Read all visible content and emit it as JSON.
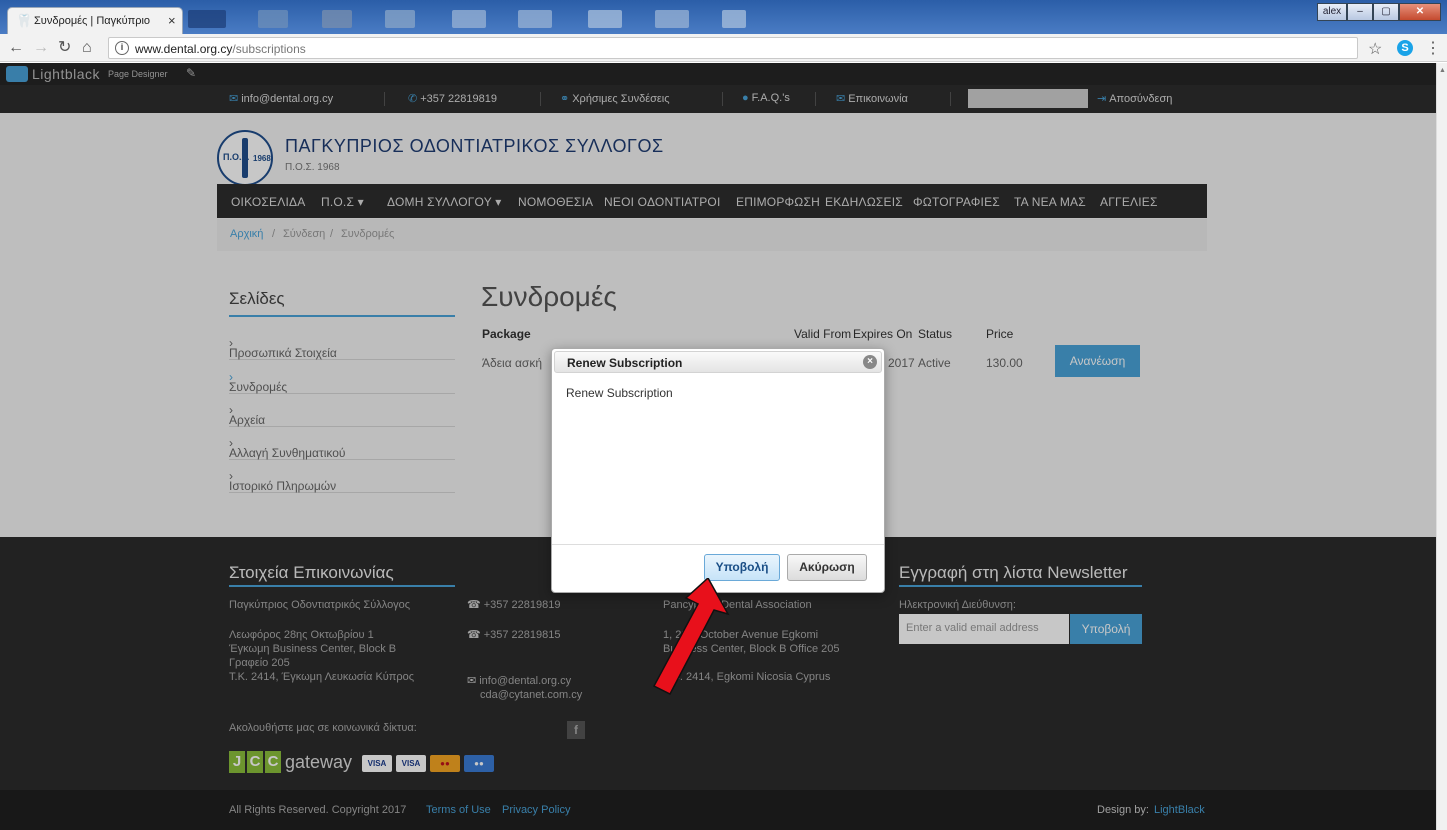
{
  "browser": {
    "tab_title": "Συνδρομές | Παγκύπριο",
    "url_host": "www.dental.org.cy",
    "url_path": "/subscriptions",
    "window_user": "alex"
  },
  "lightblack": {
    "brand": "Lightblack",
    "sub": "Page Designer"
  },
  "topbar": {
    "email": "info@dental.org.cy",
    "phone": "+357 22819819",
    "links": "Χρήσιμες Συνδέσεις",
    "faq": "F.A.Q.'s",
    "contact": "Επικοινωνία",
    "logout": "Αποσύνδεση"
  },
  "header": {
    "logo_text": "Π.Ο.Σ.",
    "logo_year": "1968",
    "title": "ΠΑΓΚΥΠΡΙΟΣ ΟΔΟΝΤΙΑΤΡΙΚΟΣ ΣΥΛΛΟΓΟΣ",
    "subtitle": "Π.Ο.Σ. 1968"
  },
  "nav": [
    "ΟΙΚΟΣΕΛΙΔΑ",
    "Π.Ο.Σ ▾",
    "ΔΟΜΗ ΣΥΛΛΟΓΟΥ ▾",
    "ΝΟΜΟΘΕΣΙΑ",
    "ΝΕΟΙ ΟΔΟΝΤΙΑΤΡΟΙ",
    "ΕΠΙΜΟΡΦΩΣΗ",
    "ΕΚΔΗΛΩΣΕΙΣ",
    "ΦΩΤΟΓΡΑΦΙΕΣ",
    "ΤΑ ΝΕΑ ΜΑΣ",
    "ΑΓΓΕΛΙΕΣ"
  ],
  "breadcrumb": {
    "home": "Αρχική",
    "sep": "/",
    "login": "Σύνδεση",
    "current": "Συνδρομές"
  },
  "sidebar": {
    "title": "Σελίδες",
    "items": [
      "Προσωπικά Στοιχεία",
      "Συνδρομές",
      "Αρχεία",
      "Αλλαγή Συνθηματικού",
      "Ιστορικό Πληρωμών"
    ]
  },
  "content": {
    "title": "Συνδρομές",
    "headers": {
      "package": "Package",
      "valid_from": "Valid From",
      "expires_on": "Expires On",
      "status": "Status",
      "price": "Price"
    },
    "row": {
      "package": "Άδεια ασκή",
      "expires_on": "2017",
      "status": "Active",
      "price": "130.00"
    },
    "renew": "Ανανέωση"
  },
  "modal": {
    "title": "Renew Subscription",
    "body": "Renew Subscription",
    "submit": "Υποβολή",
    "cancel": "Ακύρωση"
  },
  "footer": {
    "contact_title": "Στοιχεία Επικοινωνίας",
    "org_gr": "Παγκύπριος Οδοντιατρικός Σύλλογος",
    "addr_gr_1": "Λεωφόρος 28ης Οκτωβρίου 1",
    "addr_gr_2": "Έγκωμη Business Center, Block B",
    "addr_gr_3": "Γραφείο 205",
    "addr_gr_4": "Τ.Κ. 2414, Έγκωμη Λευκωσία Κύπρος",
    "phone1": "+357 22819819",
    "phone2": "+357 22819815",
    "email1": "info@dental.org.cy",
    "email2": "cda@cytanet.com.cy",
    "org_en": "Pancyprian Dental Association",
    "addr_en_1": "1, 28th October Avenue Egkomi",
    "addr_en_2": "Business Center, Block B Office 205",
    "addr_en_3": "P.C. 2414, Egkomi Nicosia Cyprus",
    "social": "Ακολουθήστε μας σε κοινωνικά δίκτυα:",
    "newsletter_title": "Εγγραφή στη λίστα Newsletter",
    "newsletter_label": "Ηλεκτρονική Διεύθυνση:",
    "newsletter_placeholder": "Enter a valid email address",
    "newsletter_submit": "Υποβολή",
    "gateway": "gateway",
    "copyright": "All Rights Reserved. Copyright 2017",
    "terms": "Terms of Use",
    "privacy": "Privacy Policy",
    "design_by": "Design by:",
    "design_link": "LightBlack"
  },
  "colors": {
    "accent": "#49a3d9",
    "navbar": "#2e2e2e",
    "title_blue": "#1e3c72",
    "annotation": "#e8101b"
  }
}
